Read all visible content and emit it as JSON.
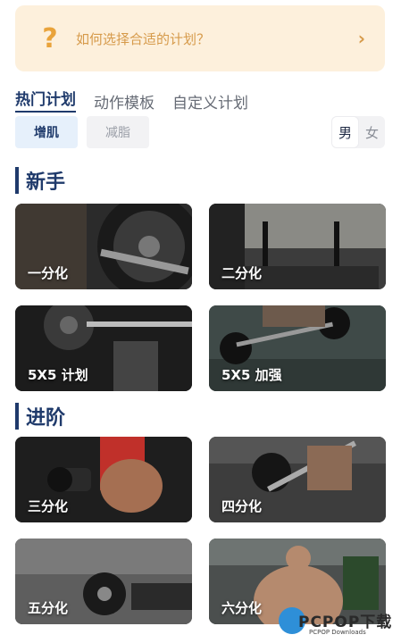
{
  "banner": {
    "icon": "question-icon",
    "text": "如何选择合适的计划？"
  },
  "tabs": [
    {
      "label": "热门计划",
      "active": true
    },
    {
      "label": "动作模板",
      "active": false
    },
    {
      "label": "自定义计划",
      "active": false
    }
  ],
  "goals": [
    {
      "label": "增肌",
      "selected": true
    },
    {
      "label": "减脂",
      "selected": false
    }
  ],
  "gender": {
    "male": "男",
    "female": "女",
    "selected": "男"
  },
  "sections": [
    {
      "title": "新手",
      "cards": [
        "一分化",
        "二分化",
        "5X5 计划",
        "5X5 加强"
      ]
    },
    {
      "title": "进阶",
      "cards": [
        "三分化",
        "四分化",
        "五分化",
        "六分化"
      ]
    }
  ],
  "watermark": {
    "brand": "PCPOP下载",
    "sub": "PCPOP Downloads"
  },
  "colors": {
    "accent": "#1f3a6b",
    "banner_bg": "#fdf0dc",
    "banner_text": "#d69a4a"
  }
}
